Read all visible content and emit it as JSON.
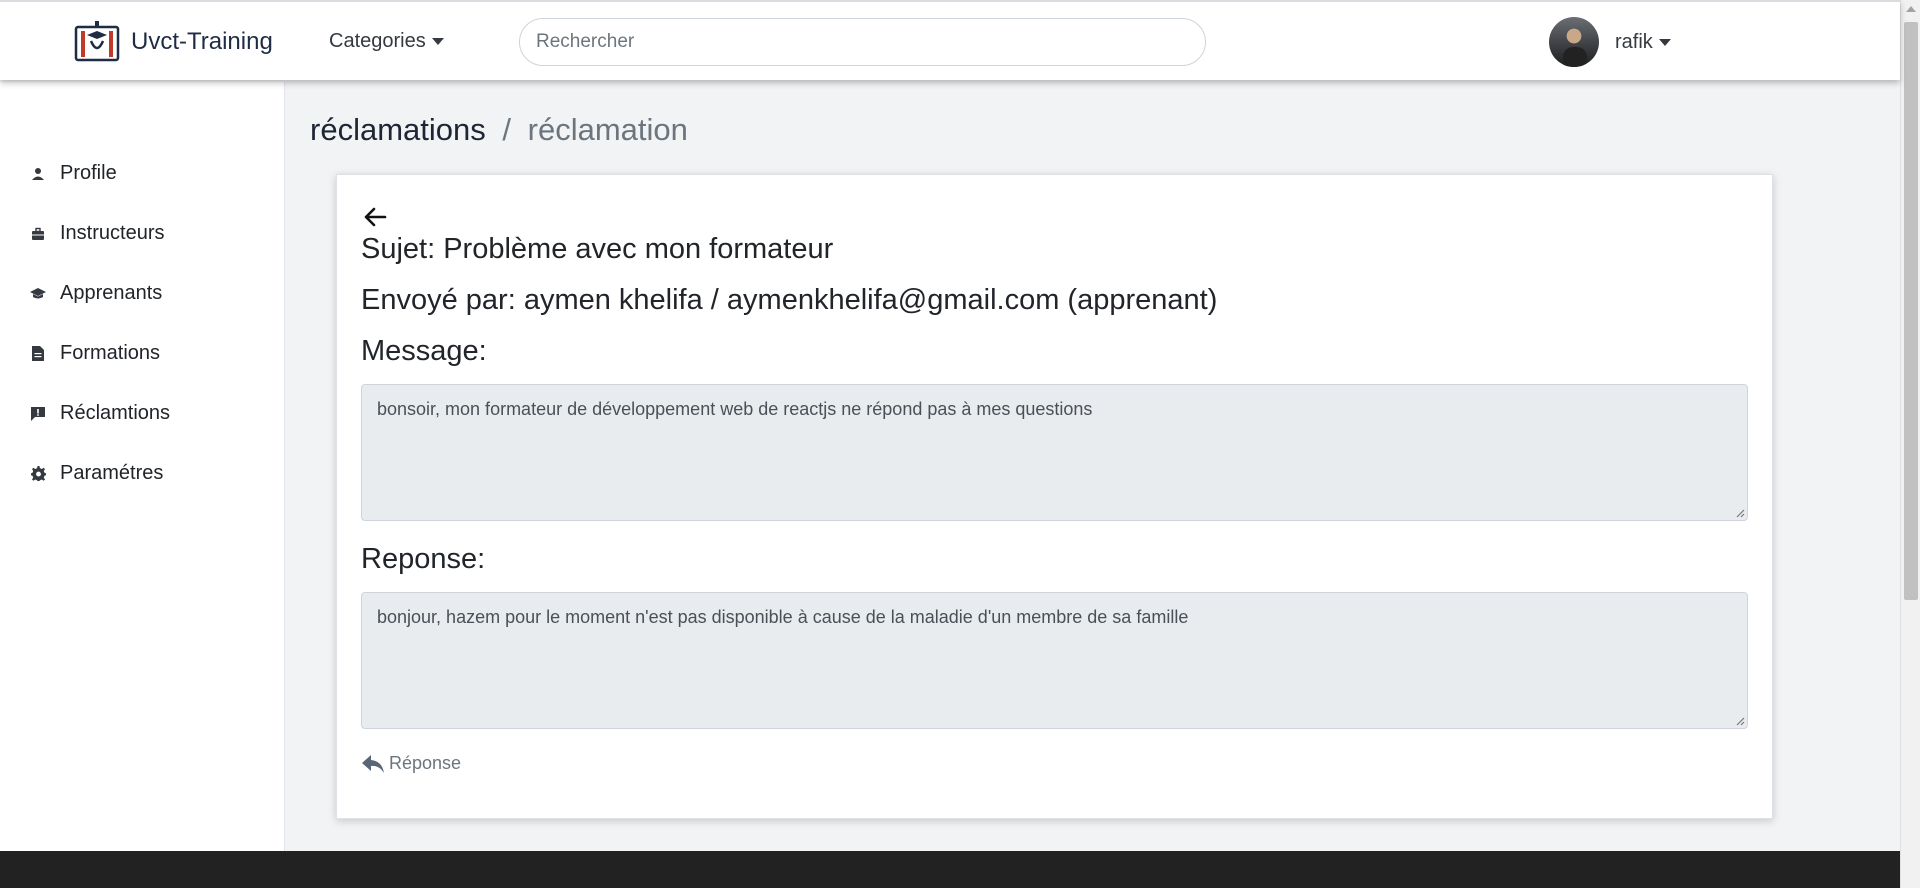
{
  "navbar": {
    "brand": "Uvct-Training",
    "categories_label": "Categories",
    "search_placeholder": "Rechercher",
    "username": "rafik"
  },
  "sidebar": {
    "items": [
      {
        "label": "Profile",
        "icon": "user-icon"
      },
      {
        "label": "Instructeurs",
        "icon": "briefcase-icon"
      },
      {
        "label": "Apprenants",
        "icon": "graduation-cap-icon"
      },
      {
        "label": "Formations",
        "icon": "document-icon"
      },
      {
        "label": "Réclamtions",
        "icon": "comment-alert-icon"
      },
      {
        "label": "Paramétres",
        "icon": "gear-icon"
      }
    ]
  },
  "breadcrumb": {
    "main": "réclamations",
    "separator": "/",
    "sub": "réclamation"
  },
  "reclamation": {
    "subject_line": "Sujet: Problème avec mon formateur",
    "sender_line": "Envoyé par: aymen khelifa / aymenkhelifa@gmail.com (apprenant)",
    "message_label": "Message:",
    "message_text": "bonsoir, mon formateur de développement web de reactjs ne répond pas à mes questions",
    "response_label": "Reponse:",
    "response_text": "bonjour, hazem pour le moment n'est pas disponible à cause de la maladie d'un membre de sa famille",
    "reply_button": "Réponse"
  },
  "colors": {
    "background": "#f1f3f5",
    "textbox_bg": "#e9ecef",
    "footer": "#222222",
    "muted": "#6c757d"
  }
}
